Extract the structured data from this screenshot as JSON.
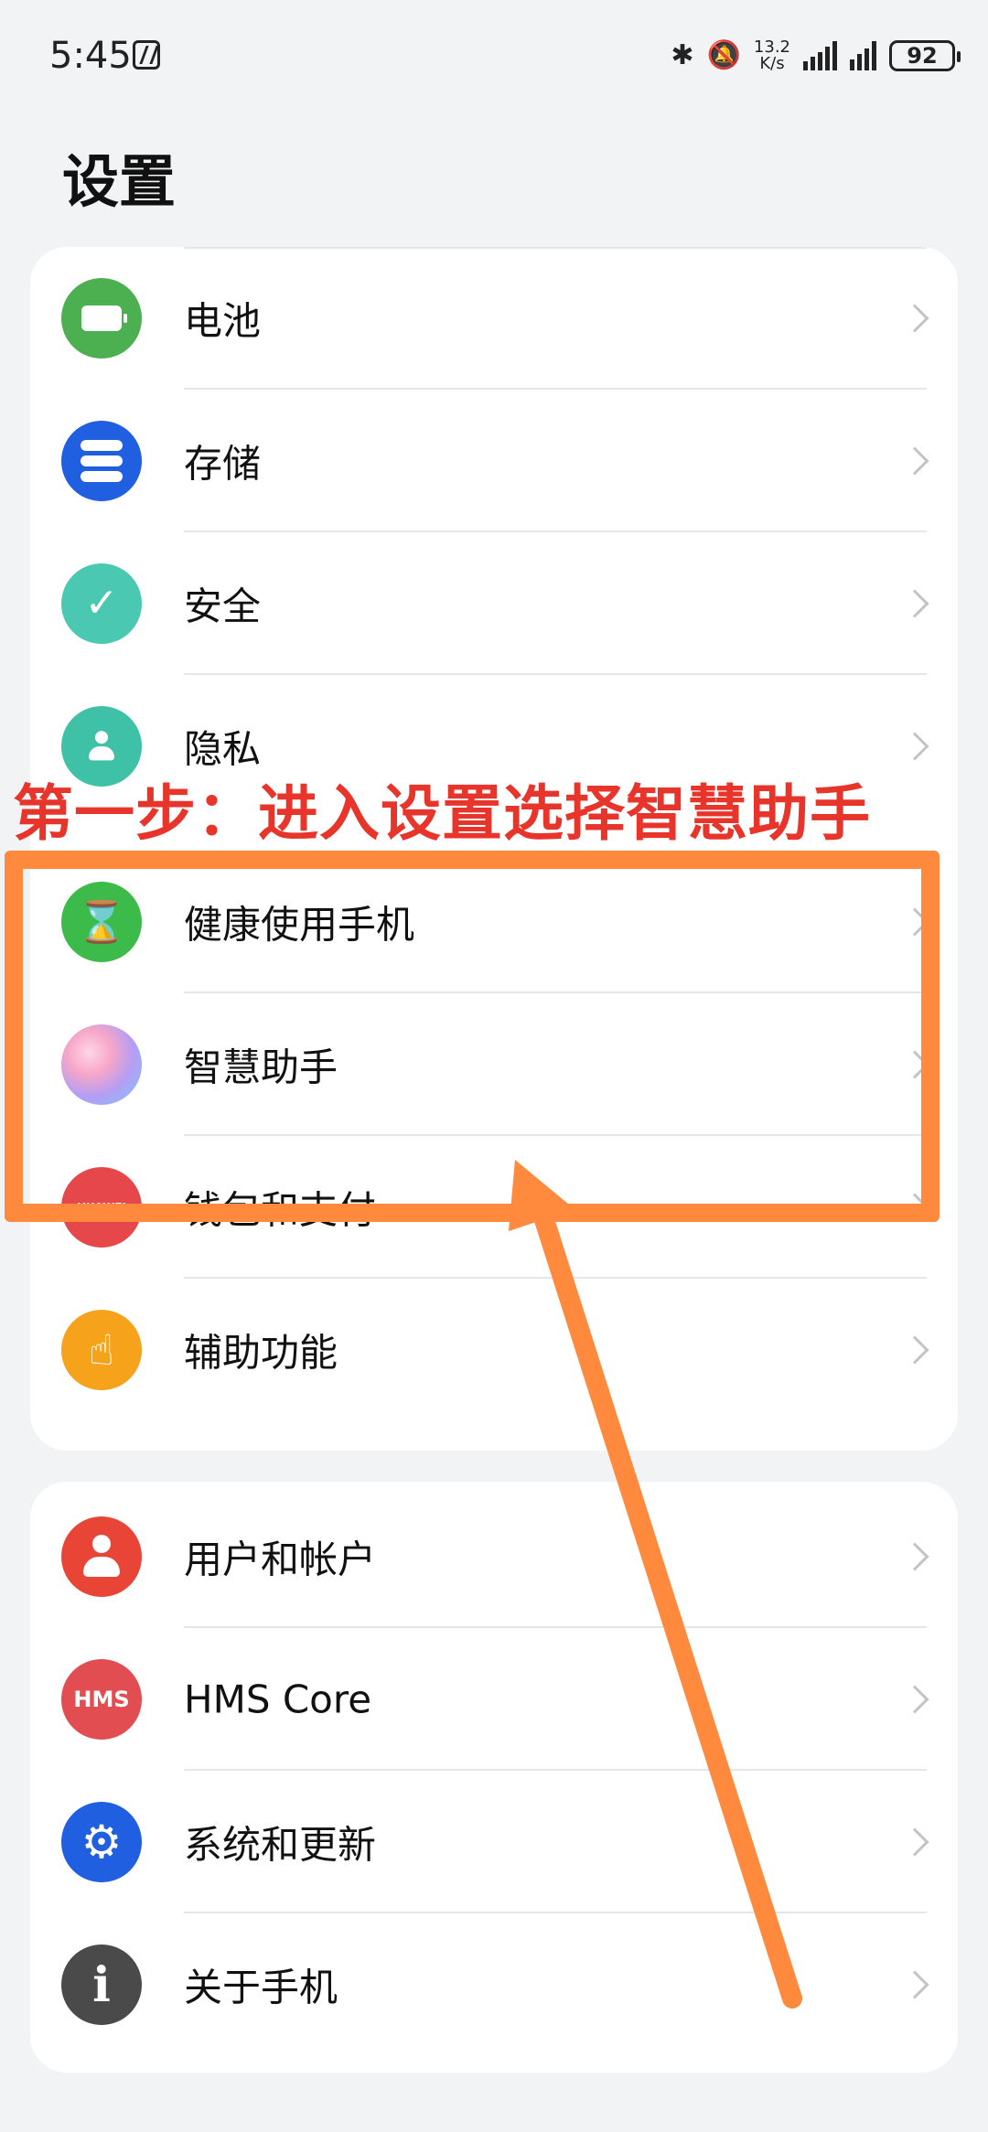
{
  "status_bar": {
    "time": "5:45",
    "net_speed_value": "13.2",
    "net_speed_unit": "K/s",
    "battery_level": "92",
    "bluetooth_icon": "bluetooth-icon",
    "mute_icon": "bell-off-icon"
  },
  "page_title": "设置",
  "annotation": {
    "title": "第一步：进入设置选择智慧助手",
    "color": "#e8352b",
    "highlight_color": "#ff8a3d"
  },
  "card1": {
    "items": [
      {
        "label": "电池",
        "icon": "battery-icon",
        "color": "#4caf50"
      },
      {
        "label": "存储",
        "icon": "storage-icon",
        "color": "#1f5fe0"
      },
      {
        "label": "安全",
        "icon": "shield-check-icon",
        "color": "#4bc8b2"
      },
      {
        "label": "隐私",
        "icon": "shield-user-icon",
        "color": "#3fc1a8"
      },
      {
        "label": "健康使用手机",
        "icon": "hourglass-icon",
        "color": "#3cba4a"
      },
      {
        "label": "智慧助手",
        "icon": "assistant-icon",
        "color": "#c7a0e8"
      },
      {
        "label": "钱包和支付",
        "icon": "wallet-icon",
        "color": "#e5474b",
        "icon_text": "HUAWEI"
      },
      {
        "label": "辅助功能",
        "icon": "hand-tap-icon",
        "color": "#f6a21a"
      }
    ]
  },
  "card2": {
    "items": [
      {
        "label": "用户和帐户",
        "icon": "user-icon",
        "color": "#e84537"
      },
      {
        "label": "HMS Core",
        "icon": "hms-icon",
        "color": "#e14d50",
        "icon_text": "HMS"
      },
      {
        "label": "系统和更新",
        "icon": "gear-icon",
        "color": "#1f5fe0"
      },
      {
        "label": "关于手机",
        "icon": "info-icon",
        "color": "#4a4a4a"
      }
    ]
  }
}
